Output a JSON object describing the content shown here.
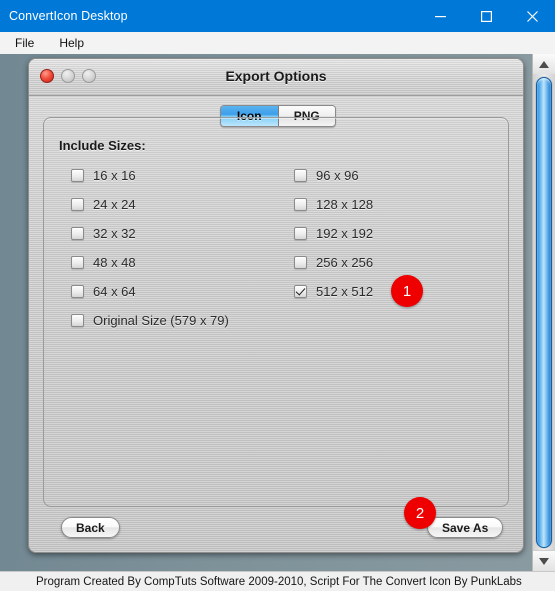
{
  "window": {
    "title": "ConvertIcon Desktop",
    "controls": [
      {
        "name": "minimize",
        "glyph": "minimize-icon"
      },
      {
        "name": "maximize",
        "glyph": "maximize-icon"
      },
      {
        "name": "close",
        "glyph": "close-icon"
      }
    ]
  },
  "menubar": {
    "items": [
      {
        "label": "File"
      },
      {
        "label": "Help"
      }
    ]
  },
  "dialog": {
    "title": "Export Options",
    "traffic_lights": [
      {
        "name": "close",
        "state": "active",
        "color": "#f4503d"
      },
      {
        "name": "minimize",
        "state": "disabled",
        "color": "#d4d4d4"
      },
      {
        "name": "zoom",
        "state": "disabled",
        "color": "#d4d4d4"
      }
    ],
    "tabs": [
      {
        "label": "Icon",
        "selected": true
      },
      {
        "label": "PNG",
        "selected": false
      }
    ],
    "group_label": "Include Sizes:",
    "sizes_left": [
      {
        "label": "16 x 16",
        "checked": false
      },
      {
        "label": "24 x 24",
        "checked": false
      },
      {
        "label": "32 x 32",
        "checked": false
      },
      {
        "label": "48 x 48",
        "checked": false
      },
      {
        "label": "64 x 64",
        "checked": false
      },
      {
        "label": "Original Size (579 x 79)",
        "checked": false
      }
    ],
    "sizes_right": [
      {
        "label": "96 x 96",
        "checked": false
      },
      {
        "label": "128 x 128",
        "checked": false
      },
      {
        "label": "192 x 192",
        "checked": false
      },
      {
        "label": "256 x 256",
        "checked": false
      },
      {
        "label": "512 x 512",
        "checked": true
      }
    ],
    "back_button": "Back",
    "save_button": "Save As"
  },
  "annotations": [
    {
      "number": "1",
      "color": "#ee0000"
    },
    {
      "number": "2",
      "color": "#ee0000"
    }
  ],
  "statusbar": {
    "text": "Program Created By CompTuts Software 2009-2010, Script For The Convert Icon By PunkLabs"
  },
  "scrollbar": {
    "up_arrow": "scroll-up-icon",
    "down_arrow": "scroll-down-icon",
    "thumb_color": "#3d9ee9"
  }
}
